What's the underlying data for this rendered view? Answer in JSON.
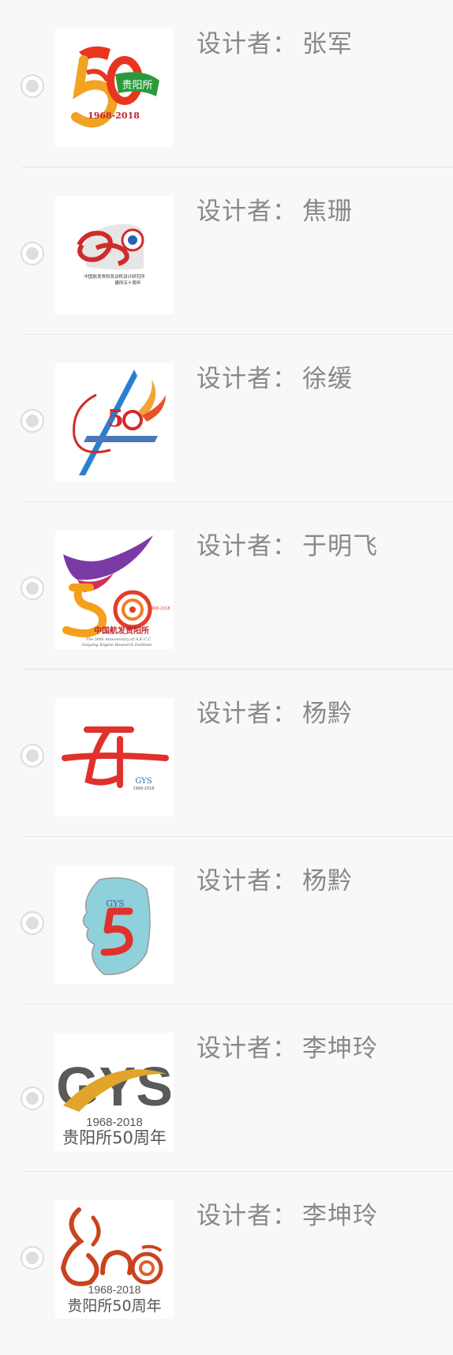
{
  "designer_prefix": "设计者：",
  "items": [
    {
      "designer": "张军",
      "logo": {
        "text_lines": [
          "贵阳所",
          "1968-2018"
        ]
      }
    },
    {
      "designer": "焦珊",
      "logo": {
        "text_lines": [
          "中国航发贵阳发动机设计研究所",
          "建所五十周年"
        ]
      }
    },
    {
      "designer": "徐缓",
      "logo": {
        "text_lines": []
      }
    },
    {
      "designer": "于明飞",
      "logo": {
        "text_lines": [
          "中国航发贵阳所",
          "The 50th Anniversary of A.E.C.C",
          "Guiyang Engine Research Institute",
          "1968-2018"
        ]
      }
    },
    {
      "designer": "杨黔",
      "logo": {
        "text_lines": [
          "GYS",
          "1968-2018"
        ]
      }
    },
    {
      "designer": "杨黔",
      "logo": {
        "text_lines": [
          "GYS"
        ]
      }
    },
    {
      "designer": "李坤玲",
      "logo": {
        "text_lines": [
          "GYS",
          "1968-2018",
          "贵阳所50周年"
        ]
      }
    },
    {
      "designer": "李坤玲",
      "logo": {
        "text_lines": [
          "1968-2018",
          "贵阳所50周年"
        ]
      }
    }
  ]
}
